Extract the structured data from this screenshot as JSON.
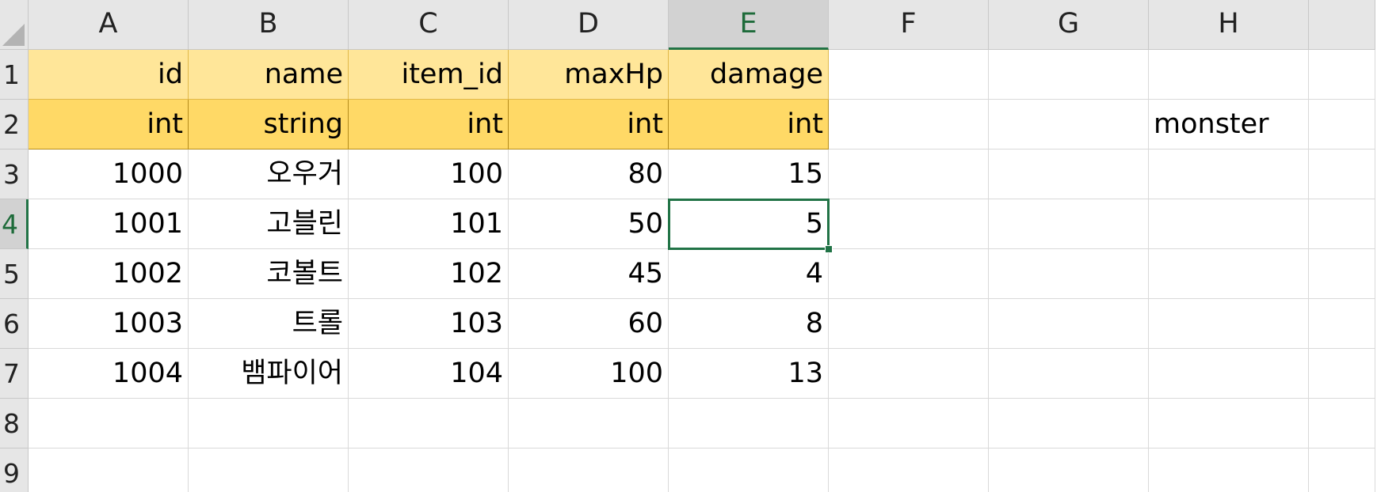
{
  "columns": [
    "A",
    "B",
    "C",
    "D",
    "E",
    "F",
    "G",
    "H",
    ""
  ],
  "rows": [
    "1",
    "2",
    "3",
    "4",
    "5",
    "6",
    "7",
    "8",
    "9"
  ],
  "cells": {
    "r1": [
      "id",
      "name",
      "item_id",
      "maxHp",
      "damage",
      "",
      "",
      "",
      ""
    ],
    "r2": [
      "int",
      "string",
      "int",
      "int",
      "int",
      "",
      "",
      "monster",
      ""
    ],
    "r3": [
      "1000",
      "오우거",
      "100",
      "80",
      "15",
      "",
      "",
      "",
      ""
    ],
    "r4": [
      "1001",
      "고블린",
      "101",
      "50",
      "5",
      "",
      "",
      "",
      ""
    ],
    "r5": [
      "1002",
      "코볼트",
      "102",
      "45",
      "4",
      "",
      "",
      "",
      ""
    ],
    "r6": [
      "1003",
      "트롤",
      "103",
      "60",
      "8",
      "",
      "",
      "",
      ""
    ],
    "r7": [
      "1004",
      "뱀파이어",
      "104",
      "100",
      "13",
      "",
      "",
      "",
      ""
    ],
    "r8": [
      "",
      "",
      "",
      "",
      "",
      "",
      "",
      "",
      ""
    ],
    "r9": [
      "",
      "",
      "",
      "",
      "",
      "",
      "",
      "",
      ""
    ]
  },
  "selection": {
    "active_cell": "E4",
    "active_column": "E",
    "active_row": "4"
  },
  "colors": {
    "header_row_1": "#ffe699",
    "header_row_2": "#ffd966",
    "selection": "#217346",
    "grid_line": "#d9d9d9"
  }
}
